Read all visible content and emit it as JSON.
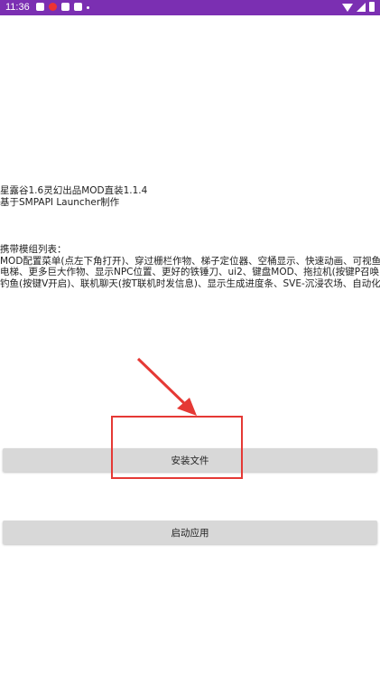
{
  "status_bar": {
    "time": "11:36",
    "icons": [
      "game-controller-icon",
      "notification-badge-icon",
      "gallery-icon",
      "document-icon",
      "dot-icon"
    ],
    "right_icons": [
      "wifi-icon",
      "signal-icon",
      "battery-icon"
    ]
  },
  "header": {
    "title_line": "星露谷1.6灵幻出品MOD直装1.1.4",
    "subtitle_line": "基于SMPAPI Launcher制作"
  },
  "mods": {
    "heading": "携带模组列表：",
    "line1": "MOD配置菜单(点左下角打开)、穿过栅栏作物、梯子定位器、空桶显示、快速动画、可视鱼、骷髅",
    "line2": "电梯、更多巨大作物、显示NPC位置、更好的铁锤刀、ui2、键盘MOD、拖拉机(按键P召唤)、自动",
    "line3": "钓鱼(按键V开启)、联机聊天(按T联机时发信息)、显示生成进度条、SVE-沉浸农场、自动化"
  },
  "buttons": {
    "install": "安装文件",
    "launch": "启动应用"
  },
  "annotation": {
    "highlight_color": "#e53935"
  }
}
